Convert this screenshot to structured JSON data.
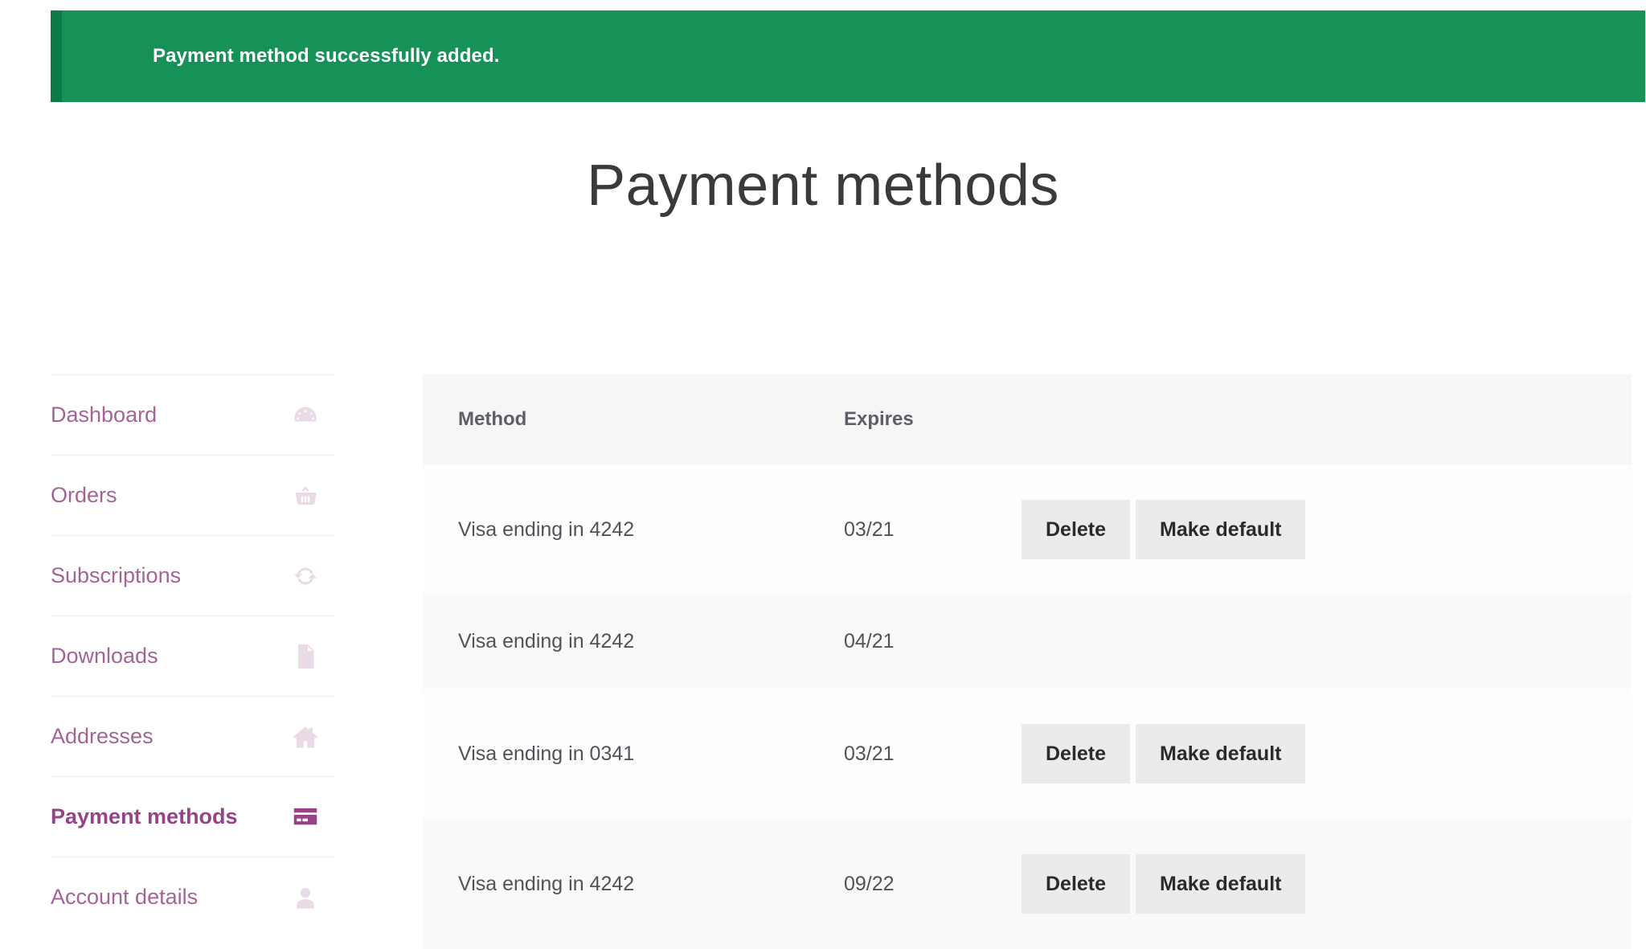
{
  "notice": {
    "message": "Payment method successfully added.",
    "bg_color": "#169157",
    "border_color": "#0f7a49"
  },
  "header": {
    "title": "Payment methods"
  },
  "sidebar": {
    "items": [
      {
        "label": "Dashboard",
        "icon": "speedometer-icon",
        "active": false
      },
      {
        "label": "Orders",
        "icon": "basket-icon",
        "active": false
      },
      {
        "label": "Subscriptions",
        "icon": "sync-icon",
        "active": false
      },
      {
        "label": "Downloads",
        "icon": "zip-file-icon",
        "active": false
      },
      {
        "label": "Addresses",
        "icon": "home-icon",
        "active": false
      },
      {
        "label": "Payment methods",
        "icon": "credit-card-icon",
        "active": true
      },
      {
        "label": "Account details",
        "icon": "user-icon",
        "active": false
      }
    ],
    "link_color": "#a46497",
    "active_color": "#96438a"
  },
  "table": {
    "columns": [
      "Method",
      "Expires",
      ""
    ],
    "rows": [
      {
        "method": "Visa ending in 4242",
        "expires": "03/21",
        "delete_label": "Delete",
        "make_default_label": "Make default",
        "has_actions": true
      },
      {
        "method": "Visa ending in 4242",
        "expires": "04/21",
        "delete_label": "",
        "make_default_label": "",
        "has_actions": false
      },
      {
        "method": "Visa ending in 0341",
        "expires": "03/21",
        "delete_label": "Delete",
        "make_default_label": "Make default",
        "has_actions": true
      },
      {
        "method": "Visa ending in 4242",
        "expires": "09/22",
        "delete_label": "Delete",
        "make_default_label": "Make default",
        "has_actions": true
      }
    ]
  }
}
